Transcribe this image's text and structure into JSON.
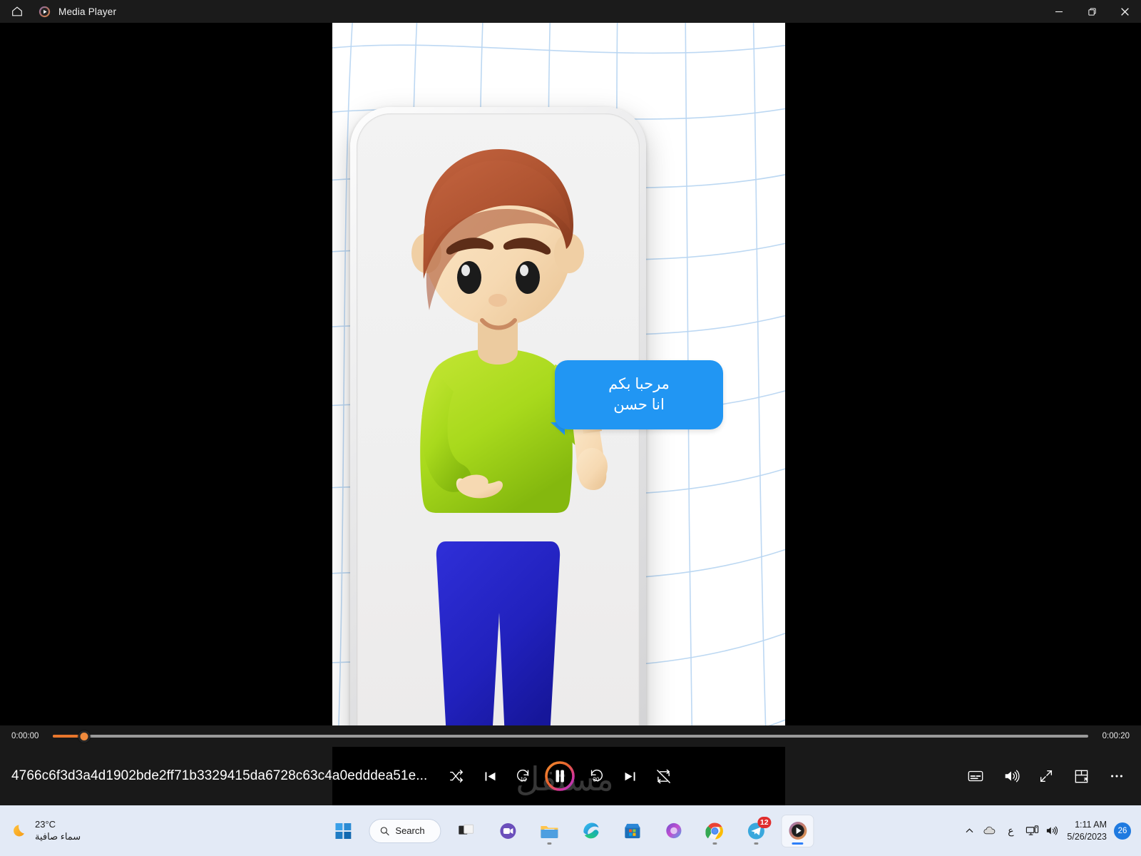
{
  "window": {
    "title": "Media Player",
    "home_icon": "home-icon",
    "app_icon": "media-player-icon",
    "minimize_label": "Minimize",
    "maximize_label": "Restore",
    "close_label": "Close"
  },
  "video": {
    "speech_bubble": {
      "line1": "مرحبا بكم",
      "line2": "انا حسن",
      "color": "#2196f3"
    },
    "character": {
      "hair_color": "#b5542f",
      "shirt_color": "#a5d71a",
      "pants_color": "#2222c8",
      "shoes_color": "#3cb8e8",
      "skin_color": "#f7ddb8"
    },
    "background": {
      "base": "#ffffff",
      "mesh_color": "#b8d4f0"
    },
    "watermark": "مستقل"
  },
  "player": {
    "current_time": "0:00:00",
    "total_time": "0:00:20",
    "progress_percent": 3,
    "accent_color": "#e8762c",
    "file_name": "4766c6f3d3a4d1902bde2ff71b3329415da6728c63c4a0edddea51e...",
    "controls": {
      "shuffle": "shuffle-icon",
      "previous": "previous-track-icon",
      "rewind": "rewind-10-icon",
      "rewind_label": "10",
      "play_pause": "pause-icon",
      "forward": "forward-30-icon",
      "forward_label": "30",
      "next": "next-track-icon",
      "repeat": "repeat-off-icon"
    },
    "right_controls": {
      "captions": "captions-icon",
      "volume": "volume-icon",
      "fullscreen": "fullscreen-icon",
      "miniplayer": "mini-player-icon",
      "more": "more-options-icon"
    }
  },
  "taskbar": {
    "weather": {
      "temperature": "23°C",
      "description": "سماء صافية",
      "icon": "crescent-moon-icon"
    },
    "search_placeholder": "Search",
    "apps": [
      {
        "name": "start-button",
        "icon": "windows-logo-icon"
      },
      {
        "name": "task-view",
        "icon": "task-view-icon"
      },
      {
        "name": "chat",
        "icon": "chat-video-icon"
      },
      {
        "name": "file-explorer",
        "icon": "folder-icon"
      },
      {
        "name": "edge",
        "icon": "edge-icon"
      },
      {
        "name": "microsoft-store",
        "icon": "store-icon"
      },
      {
        "name": "office",
        "icon": "office-icon"
      },
      {
        "name": "chrome",
        "icon": "chrome-icon"
      },
      {
        "name": "telegram",
        "icon": "telegram-icon",
        "badge": "12"
      },
      {
        "name": "media-player",
        "icon": "media-player-icon",
        "active": true
      }
    ],
    "tray": {
      "chevron": "chevron-up-icon",
      "onedrive": "cloud-icon",
      "language": "ع",
      "network": "network-icon",
      "volume": "speaker-icon",
      "time": "1:11 AM",
      "date": "5/26/2023",
      "notification_count": "26"
    }
  }
}
